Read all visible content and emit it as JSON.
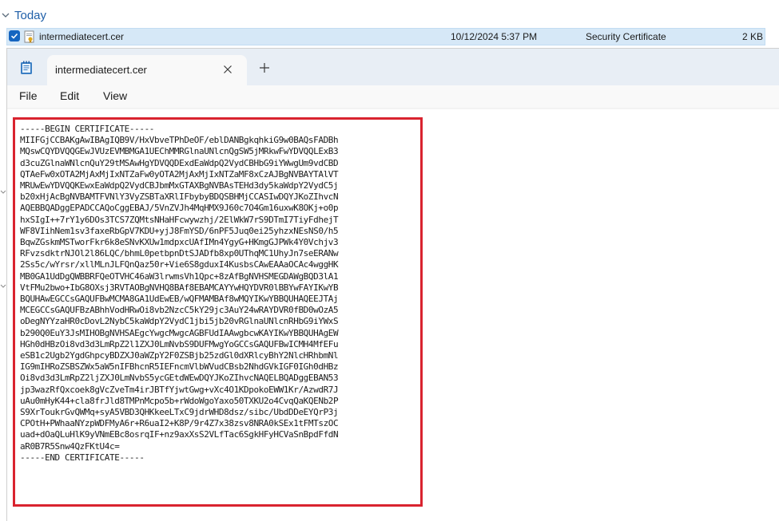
{
  "explorer": {
    "group_label": "Today",
    "file": {
      "name": "intermediatecert.cer",
      "date_modified": "10/12/2024 5:37 PM",
      "type": "Security Certificate",
      "size": "2 KB"
    }
  },
  "notepad": {
    "tab_title": "intermediatecert.cer",
    "menu": {
      "file": "File",
      "edit": "Edit",
      "view": "View"
    },
    "lines": [
      "-----BEGIN CERTIFICATE-----",
      "MIIFGjCCBAKgAwIBAgIQB9V/HxVbveTPhDeOF/eblDANBgkqhkiG9w0BAQsFADBh",
      "MQswCQYDVQQGEwJVUzEVMBMGA1UEChMMRGlnaUNlcnQgSW5jMRkwFwYDVQQLExB3",
      "d3cuZGlnaWNlcnQuY29tMSAwHgYDVQQDExdEaWdpQ2VydCBHbG9iYWwgUm9vdCBD",
      "QTAeFw0xOTA2MjAxMjIxNTZaFw0yOTA2MjAxMjIxNTZaMF8xCzAJBgNVBAYTAlVT",
      "MRUwEwYDVQQKEwxEaWdpQ2VydCBJbmMxGTAXBgNVBAsTEHd3dy5kaWdpY2VydC5j",
      "b20xHjAcBgNVBAMTFVNlY3VyZSBTaXRlIFbybyBDQSBHMjCCASIwDQYJKoZIhvcN",
      "AQEBBQADggEPADCCAQoCggEBAJ/5VnZVJh4MqHMX9J60c7O4Gm16uxwK8OKj+o0p",
      "hxSIgI++7rY1y6DOs3TCS7ZQMtsNHaHFcwywzhj/2ElWkW7rS9DTmI7TiyFdhejT",
      "WF8VIihNem1sv3faxeRbGpV7KDU+yjJ8FmYSD/6nPF5Juq0ei25yhzxNEsNS0/h5",
      "BqwZGskmMSTworFkr6k8eSNvKXUw1mdpxcUAfIMn4YgyG+HKmgGJPWk4Y0Vchjv3",
      "RFvzsdktrNJOl2l86LQC/bhmL0petbpnDtSJADfb8xp0UThqMC1UhyJn7seERANw",
      "2Ss5c/wYrsr/xllMLnJLFQnQaz50r+Vie6S8gduxI4KusbsCAwEAAaOCAc4wggHK",
      "MB0GA1UdDgQWBBRFQeOTVHC46aW3lrwmsVh1Qpc+8zAfBgNVHSMEGDAWgBQD3lA1",
      "VtFMu2bwo+IbG8OXsj3RVTAOBgNVHQ8BAf8EBAMCAYYwHQYDVR0lBBYwFAYIKwYB",
      "BQUHAwEGCCsGAQUFBwMCMA8GA1UdEwEB/wQFMAMBAf8wMQYIKwYBBQUHAQEEJTAj",
      "MCEGCCsGAQUFBzABhhVodHRwOi8vb2NzcC5kY29jc3AuY24wRAYDVR0fBD0wOzA5",
      "oDegNYYzaHR0cDovL2NybC5kaWdpY2VydC1jbi5jb20vRGlnaUNlcnRHbG9iYWxS",
      "b290Q0EuY3JsMIHOBgNVHSAEgcYwgcMwgcAGBFUdIAAwgbcwKAYIKwYBBQUHAgEW",
      "HGh0dHBzOi8vd3d3LmRpZ2l1ZXJ0LmNvbS9DUFMwgYoGCCsGAQUFBwICMH4MfEFu",
      "eSB1c2Ugb2YgdGhpcyBDZXJ0aWZpY2F0ZSBjb25zdGl0dXRlcyBhY2NlcHRhbmNl",
      "IG9mIHRoZSBSZWx5aW5nIFBhcnR5IEFncmVlbWVudCBsb2NhdGVkIGF0IGh0dHBz",
      "Oi8vd3d3LmRpZ2ljZXJ0LmNvbS5ycGEtdWEwDQYJKoZIhvcNAQELBQADggEBAN53",
      "jp3wazRfQxcoek8gVcZveTm4irJBTfYjwtGwg+vXc4O1KDpokoEWW1Kr/AzwdR7J",
      "uAu0mHyK44+cla8frJld8TMPnMcpo5b+rWdoWgoYaxo50TXKU2o4CvqQaKQENb2P",
      "S9XrToukrGvQWMq+syA5VBD3QHKkeeLTxC9jdrWHD8dsz/sibc/UbdDDeEYQrP3j",
      "CPOtH+PWhaaNYzpWDFMyA6r+R6uaI2+K8P/9r4Z7x38zsv8NRA0kSEx1tFMTszOC",
      "uad+dOaQLuHlK9yVNmEBc8osrqIF+nz9axXsS2VLfTac6SgkHFyHCVaSnBpdFfdN",
      "aR0B7R5Snw4QzFKtU4c=",
      "-----END CERTIFICATE-----"
    ]
  },
  "colors": {
    "accent": "#1565c0",
    "highlight_border": "#d9232f",
    "selected_row": "#d6e8f7"
  }
}
